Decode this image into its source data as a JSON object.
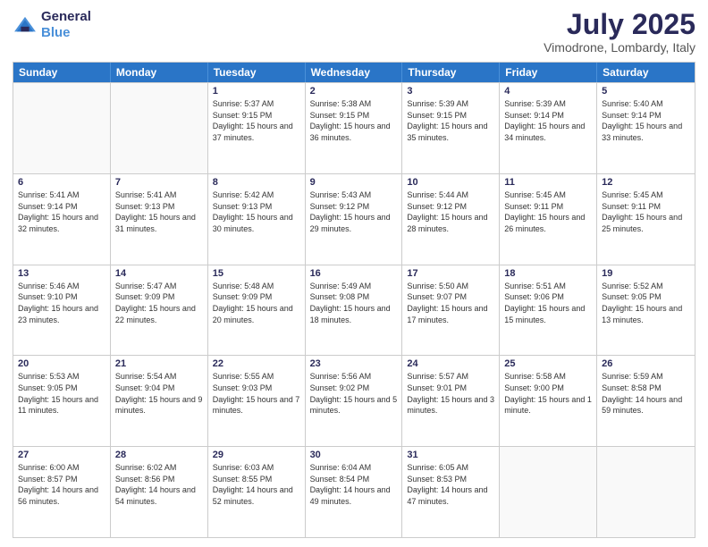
{
  "header": {
    "logo_line1": "General",
    "logo_line2": "Blue",
    "month_year": "July 2025",
    "location": "Vimodrone, Lombardy, Italy"
  },
  "days_of_week": [
    "Sunday",
    "Monday",
    "Tuesday",
    "Wednesday",
    "Thursday",
    "Friday",
    "Saturday"
  ],
  "weeks": [
    [
      {
        "day": "",
        "empty": true
      },
      {
        "day": "",
        "empty": true
      },
      {
        "day": "1",
        "sunrise": "5:37 AM",
        "sunset": "9:15 PM",
        "daylight": "15 hours and 37 minutes."
      },
      {
        "day": "2",
        "sunrise": "5:38 AM",
        "sunset": "9:15 PM",
        "daylight": "15 hours and 36 minutes."
      },
      {
        "day": "3",
        "sunrise": "5:39 AM",
        "sunset": "9:15 PM",
        "daylight": "15 hours and 35 minutes."
      },
      {
        "day": "4",
        "sunrise": "5:39 AM",
        "sunset": "9:14 PM",
        "daylight": "15 hours and 34 minutes."
      },
      {
        "day": "5",
        "sunrise": "5:40 AM",
        "sunset": "9:14 PM",
        "daylight": "15 hours and 33 minutes."
      }
    ],
    [
      {
        "day": "6",
        "sunrise": "5:41 AM",
        "sunset": "9:14 PM",
        "daylight": "15 hours and 32 minutes."
      },
      {
        "day": "7",
        "sunrise": "5:41 AM",
        "sunset": "9:13 PM",
        "daylight": "15 hours and 31 minutes."
      },
      {
        "day": "8",
        "sunrise": "5:42 AM",
        "sunset": "9:13 PM",
        "daylight": "15 hours and 30 minutes."
      },
      {
        "day": "9",
        "sunrise": "5:43 AM",
        "sunset": "9:12 PM",
        "daylight": "15 hours and 29 minutes."
      },
      {
        "day": "10",
        "sunrise": "5:44 AM",
        "sunset": "9:12 PM",
        "daylight": "15 hours and 28 minutes."
      },
      {
        "day": "11",
        "sunrise": "5:45 AM",
        "sunset": "9:11 PM",
        "daylight": "15 hours and 26 minutes."
      },
      {
        "day": "12",
        "sunrise": "5:45 AM",
        "sunset": "9:11 PM",
        "daylight": "15 hours and 25 minutes."
      }
    ],
    [
      {
        "day": "13",
        "sunrise": "5:46 AM",
        "sunset": "9:10 PM",
        "daylight": "15 hours and 23 minutes."
      },
      {
        "day": "14",
        "sunrise": "5:47 AM",
        "sunset": "9:09 PM",
        "daylight": "15 hours and 22 minutes."
      },
      {
        "day": "15",
        "sunrise": "5:48 AM",
        "sunset": "9:09 PM",
        "daylight": "15 hours and 20 minutes."
      },
      {
        "day": "16",
        "sunrise": "5:49 AM",
        "sunset": "9:08 PM",
        "daylight": "15 hours and 18 minutes."
      },
      {
        "day": "17",
        "sunrise": "5:50 AM",
        "sunset": "9:07 PM",
        "daylight": "15 hours and 17 minutes."
      },
      {
        "day": "18",
        "sunrise": "5:51 AM",
        "sunset": "9:06 PM",
        "daylight": "15 hours and 15 minutes."
      },
      {
        "day": "19",
        "sunrise": "5:52 AM",
        "sunset": "9:05 PM",
        "daylight": "15 hours and 13 minutes."
      }
    ],
    [
      {
        "day": "20",
        "sunrise": "5:53 AM",
        "sunset": "9:05 PM",
        "daylight": "15 hours and 11 minutes."
      },
      {
        "day": "21",
        "sunrise": "5:54 AM",
        "sunset": "9:04 PM",
        "daylight": "15 hours and 9 minutes."
      },
      {
        "day": "22",
        "sunrise": "5:55 AM",
        "sunset": "9:03 PM",
        "daylight": "15 hours and 7 minutes."
      },
      {
        "day": "23",
        "sunrise": "5:56 AM",
        "sunset": "9:02 PM",
        "daylight": "15 hours and 5 minutes."
      },
      {
        "day": "24",
        "sunrise": "5:57 AM",
        "sunset": "9:01 PM",
        "daylight": "15 hours and 3 minutes."
      },
      {
        "day": "25",
        "sunrise": "5:58 AM",
        "sunset": "9:00 PM",
        "daylight": "15 hours and 1 minute."
      },
      {
        "day": "26",
        "sunrise": "5:59 AM",
        "sunset": "8:58 PM",
        "daylight": "14 hours and 59 minutes."
      }
    ],
    [
      {
        "day": "27",
        "sunrise": "6:00 AM",
        "sunset": "8:57 PM",
        "daylight": "14 hours and 56 minutes."
      },
      {
        "day": "28",
        "sunrise": "6:02 AM",
        "sunset": "8:56 PM",
        "daylight": "14 hours and 54 minutes."
      },
      {
        "day": "29",
        "sunrise": "6:03 AM",
        "sunset": "8:55 PM",
        "daylight": "14 hours and 52 minutes."
      },
      {
        "day": "30",
        "sunrise": "6:04 AM",
        "sunset": "8:54 PM",
        "daylight": "14 hours and 49 minutes."
      },
      {
        "day": "31",
        "sunrise": "6:05 AM",
        "sunset": "8:53 PM",
        "daylight": "14 hours and 47 minutes."
      },
      {
        "day": "",
        "empty": true
      },
      {
        "day": "",
        "empty": true
      }
    ]
  ],
  "labels": {
    "sunrise": "Sunrise:",
    "sunset": "Sunset:",
    "daylight": "Daylight:"
  }
}
